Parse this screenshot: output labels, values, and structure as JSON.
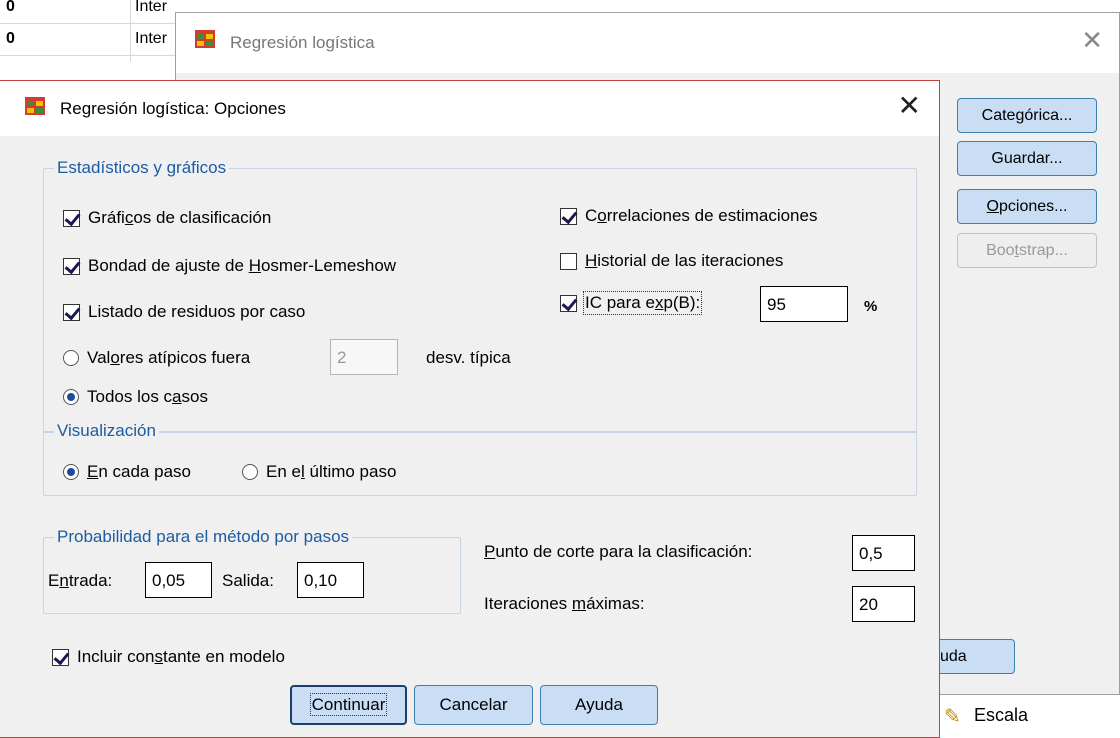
{
  "background": {
    "rows": [
      {
        "num": "0",
        "type": "Inter"
      },
      {
        "num": "0",
        "type": "Inter"
      }
    ],
    "scale_label": "Escala"
  },
  "back_dialog": {
    "title": "Regresión logística",
    "buttons": {
      "categorica": "Categórica...",
      "guardar": "Guardar...",
      "opciones": "Opciones...",
      "bootstrap": "Bootstrap...",
      "ayuda_partial": "uda"
    }
  },
  "dialog": {
    "title": "Regresión logística: Opciones",
    "stats_group": {
      "legend": "Estadísticos y gráficos",
      "graficos_clasificacion": {
        "label": "Gráficos de clasificación",
        "checked": true
      },
      "bondad_ajuste": {
        "label": "Bondad de ajuste de Hosmer-Lemeshow",
        "checked": true
      },
      "listado_residuos": {
        "label": "Listado de residuos por caso",
        "checked": true
      },
      "valores_atipicos": {
        "label": "Valores atípicos fuera",
        "value": "2",
        "unit": "desv. típica",
        "selected": false
      },
      "todos_casos": {
        "label": "Todos los casos",
        "selected": true
      },
      "correlaciones": {
        "label": "Correlaciones de estimaciones",
        "checked": true
      },
      "historial": {
        "label": "Historial de las iteraciones",
        "checked": false
      },
      "ic_exp": {
        "label": "IC para exp(B):",
        "checked": true,
        "value": "95",
        "unit": "%"
      }
    },
    "visualizacion_group": {
      "legend": "Visualización",
      "en_cada_paso": {
        "label": "En cada paso",
        "selected": true
      },
      "en_ultimo_paso": {
        "label": "En el último paso",
        "selected": false
      }
    },
    "probabilidad_group": {
      "legend": "Probabilidad para el método por pasos",
      "entrada_label": "Entrada:",
      "entrada_value": "0,05",
      "salida_label": "Salida:",
      "salida_value": "0,10"
    },
    "punto_corte": {
      "label": "Punto de corte para la clasificación:",
      "value": "0,5"
    },
    "iteraciones": {
      "label": "Iteraciones máximas:",
      "value": "20"
    },
    "incluir_constante": {
      "label": "Incluir constante en modelo",
      "checked": true
    },
    "buttons": {
      "continuar": "Continuar",
      "cancelar": "Cancelar",
      "ayuda": "Ayuda"
    }
  },
  "colors": {
    "legend": "#1c5ca3",
    "button_bg": "#c9def5",
    "button_border": "#3c7fb1",
    "dialog_border": "#c94040"
  }
}
